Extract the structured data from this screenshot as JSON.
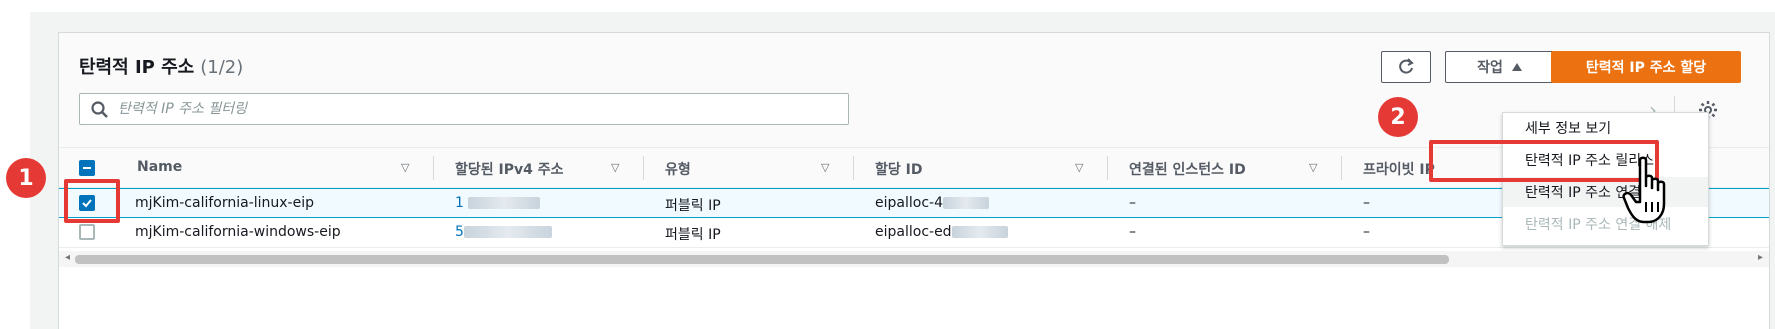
{
  "panel": {
    "title": "탄력적 IP 주소",
    "count": "(1/2)",
    "search_placeholder": "탄력적 IP 주소 필터링",
    "refresh_icon": "refresh-icon",
    "actions_label": "작업",
    "allocate_label": "탄력적 IP 주소 할당",
    "pager_next": "›",
    "settings_icon": "gear-icon"
  },
  "table": {
    "columns": [
      "Name",
      "할당된 IPv4 주소",
      "유형",
      "할당 ID",
      "연결된 인스턴스 ID",
      "프라이빗 IP"
    ],
    "rows": [
      {
        "name": "mjKim-california-linux-eip",
        "ip_prefix": "1",
        "type": "퍼블릭 IP",
        "alloc_prefix": "eipalloc-4",
        "instance": "–",
        "private": "–",
        "selected": true
      },
      {
        "name": "mjKim-california-windows-eip",
        "ip_prefix": "5",
        "type": "퍼블릭 IP",
        "alloc_prefix": "eipalloc-ed",
        "instance": "–",
        "private": "–",
        "extra": "–",
        "selected": false
      }
    ]
  },
  "menu": {
    "items": [
      {
        "label": "세부 정보 보기",
        "state": "enabled"
      },
      {
        "label": "탄력적 IP 주소 릴리스",
        "state": "enabled"
      },
      {
        "label": "탄력적 IP 주소 연결",
        "state": "hover"
      },
      {
        "label": "탄력적 IP 주소 연결 해제",
        "state": "disabled"
      }
    ]
  },
  "annotations": {
    "step1": "1",
    "step2": "2",
    "highlight_color": "#e53935"
  },
  "colors": {
    "primary": "#ec7211",
    "selected_row": "#f1faff",
    "checkbox": "#0073bb"
  }
}
